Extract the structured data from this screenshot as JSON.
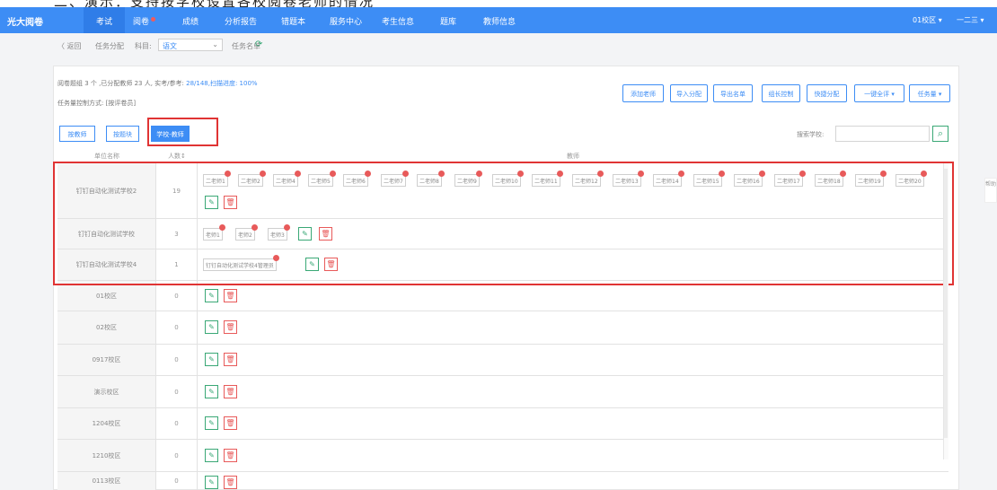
{
  "top_strip_text": "二、演示：支持按学校设置各校阅卷老师的情况",
  "nav": {
    "brand": "光大阅卷",
    "items": [
      {
        "label": "考试"
      },
      {
        "label": "阅卷"
      },
      {
        "label": "成绩"
      },
      {
        "label": "分析报告"
      },
      {
        "label": "错题本"
      },
      {
        "label": "服务中心"
      },
      {
        "label": "考生信息"
      },
      {
        "label": "题库"
      },
      {
        "label": "教师信息"
      }
    ],
    "campus": "01校区 ▾",
    "user": "一二三 ▾"
  },
  "crumb": {
    "back": "〈 返回",
    "task_dist": "任务分配",
    "subject_label": "科目:",
    "subject_value": "语文",
    "task_list": "任务名单",
    "refresh": "⟳"
  },
  "info": {
    "prefix": "阅卷题组 3 个 ,已分配教师 23 人, 实考/参考: ",
    "progress": "28/148,扫描进度: 100%",
    "control": "任务量控制方式: [按评卷员]"
  },
  "toolbar": {
    "add_teacher": "添加老师",
    "import": "导入分配",
    "export": "导出名单",
    "leader": "组长控制",
    "quick": "快捷分配",
    "select_all": "一键全评",
    "task_qty": "任务量"
  },
  "views": {
    "by_teacher": "按教师",
    "by_block": "按题块",
    "school_teacher": "学校-教师"
  },
  "search": {
    "label": "搜索学校:",
    "placeholder": "",
    "icon": "search-icon"
  },
  "table": {
    "headers": {
      "school": "单位名称",
      "count": "人数↕",
      "teachers": "教师"
    },
    "rows": [
      {
        "school": "钉钉自动化测试学校2",
        "count": "19"
      },
      {
        "school": "钉钉自动化测试学校",
        "count": "3"
      },
      {
        "school": "钉钉自动化测试学校4",
        "count": "1"
      },
      {
        "school": "01校区",
        "count": "0"
      },
      {
        "school": "02校区",
        "count": "0"
      },
      {
        "school": "0917校区",
        "count": "0"
      },
      {
        "school": "演示校区",
        "count": "0"
      },
      {
        "school": "1204校区",
        "count": "0"
      },
      {
        "school": "1210校区",
        "count": "0"
      },
      {
        "school": "0113校区",
        "count": "0"
      }
    ],
    "row1_teachers": [
      "二老师1",
      "二老师2",
      "二老师4",
      "二老师5",
      "二老师6",
      "二老师7",
      "二老师8",
      "二老师9",
      "二老师10",
      "二老师11",
      "二老师12",
      "二老师13",
      "二老师14",
      "二老师15",
      "二老师16",
      "二老师17",
      "二老师18",
      "二老师19",
      "二老师20"
    ],
    "row2_teachers": [
      "老师1",
      "老师2",
      "老师3"
    ],
    "row3_teachers": [
      "钉钉自动化测试学校4管理员"
    ]
  },
  "icons": {
    "edit": "✎",
    "delete": "🗑"
  },
  "side_tab": "帮助",
  "colors": {
    "primary": "#3d8df5",
    "edit": "#3aa876",
    "delete": "#e85a5a",
    "highlight": "#e03434"
  }
}
